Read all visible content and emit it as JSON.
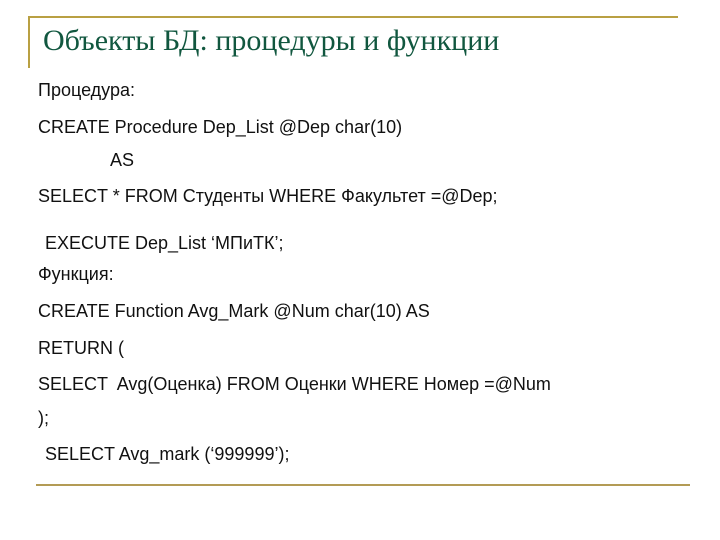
{
  "slide": {
    "title": "Объекты БД: процедуры и функции",
    "colors": {
      "title": "#11573f",
      "rule": "#b9a043",
      "text": "#111111"
    },
    "lines": [
      "Процедура:",
      "CREATE Procedure Dep_List @Dep char(10)",
      "AS",
      "SELECT * FROM Студенты WHERE Факультет =@Dep;",
      " EXECUTE Dep_List ‘МПиТК’;",
      "Функция:",
      "CREATE Function Avg_Mark @Num char(10) AS",
      "RETURN (",
      "SELECT  Avg(Оценка) FROM Оценки WHERE Номер =@Num",
      ");",
      " SELECT Avg_mark (‘999999’);"
    ]
  }
}
